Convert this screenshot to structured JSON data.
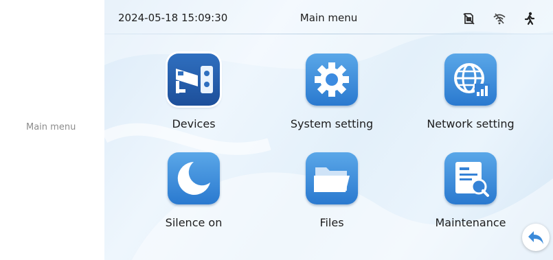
{
  "side_label": "Main menu",
  "status_bar": {
    "datetime": "2024-05-18 15:09:30",
    "title": "Main menu",
    "icons": [
      "sd-card-missing-icon",
      "wifi-off-icon",
      "motion-person-icon"
    ]
  },
  "menu": {
    "items": [
      {
        "label": "Devices",
        "icon": "camera-devices-icon"
      },
      {
        "label": "System setting",
        "icon": "gear-icon"
      },
      {
        "label": "Network setting",
        "icon": "globe-network-icon"
      },
      {
        "label": "Silence on",
        "icon": "moon-icon"
      },
      {
        "label": "Files",
        "icon": "folder-icon"
      },
      {
        "label": "Maintenance",
        "icon": "maintenance-document-icon"
      }
    ]
  },
  "back_button": {
    "icon": "back-arrow-icon"
  },
  "colors": {
    "icon_gradient_top": "#5aa7e8",
    "icon_gradient_bottom": "#2a79cf",
    "selected_icon": "#1d4f9a",
    "text": "#1d1d1d",
    "back_arrow": "#3b8ad9"
  }
}
